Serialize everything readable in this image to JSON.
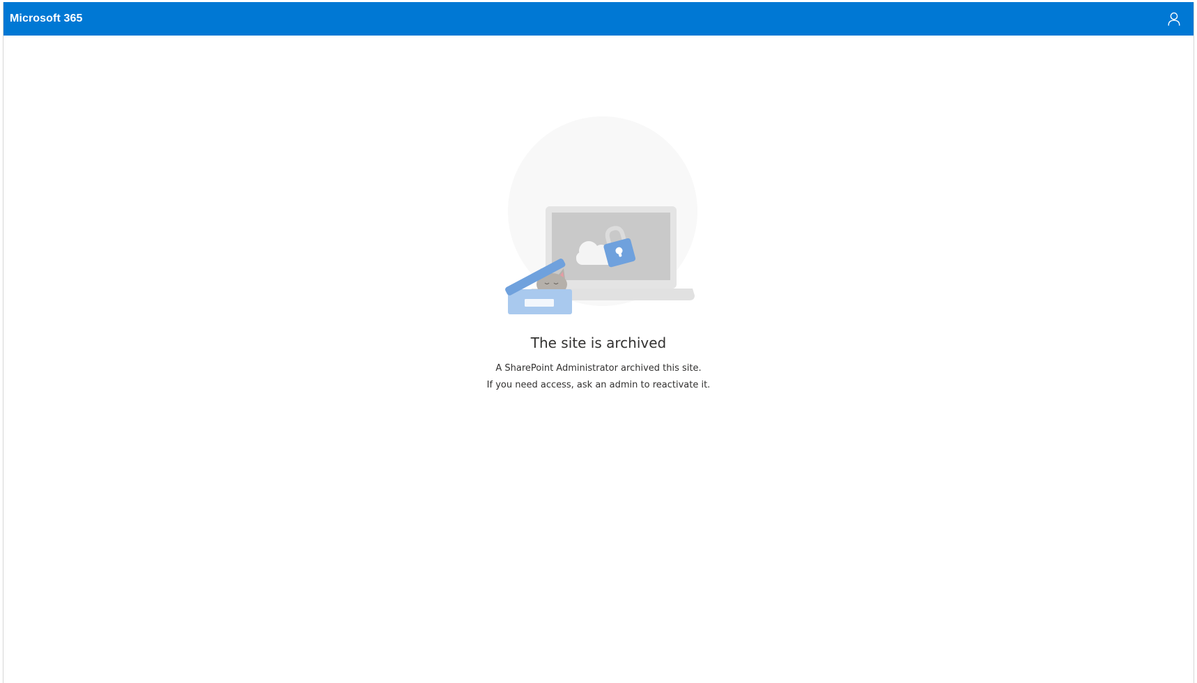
{
  "header": {
    "brand": "Microsoft 365",
    "account_icon": "person-icon",
    "background": "#0078d4"
  },
  "illustration": {
    "icons": [
      "laptop-icon",
      "cloud-icon",
      "padlock-icon",
      "archive-box-icon",
      "sleeping-cat-icon"
    ]
  },
  "message": {
    "title": "The site is archived",
    "line1": "A SharePoint Administrator archived this site.",
    "line2": "If you need access, ask an admin to reactivate it."
  }
}
